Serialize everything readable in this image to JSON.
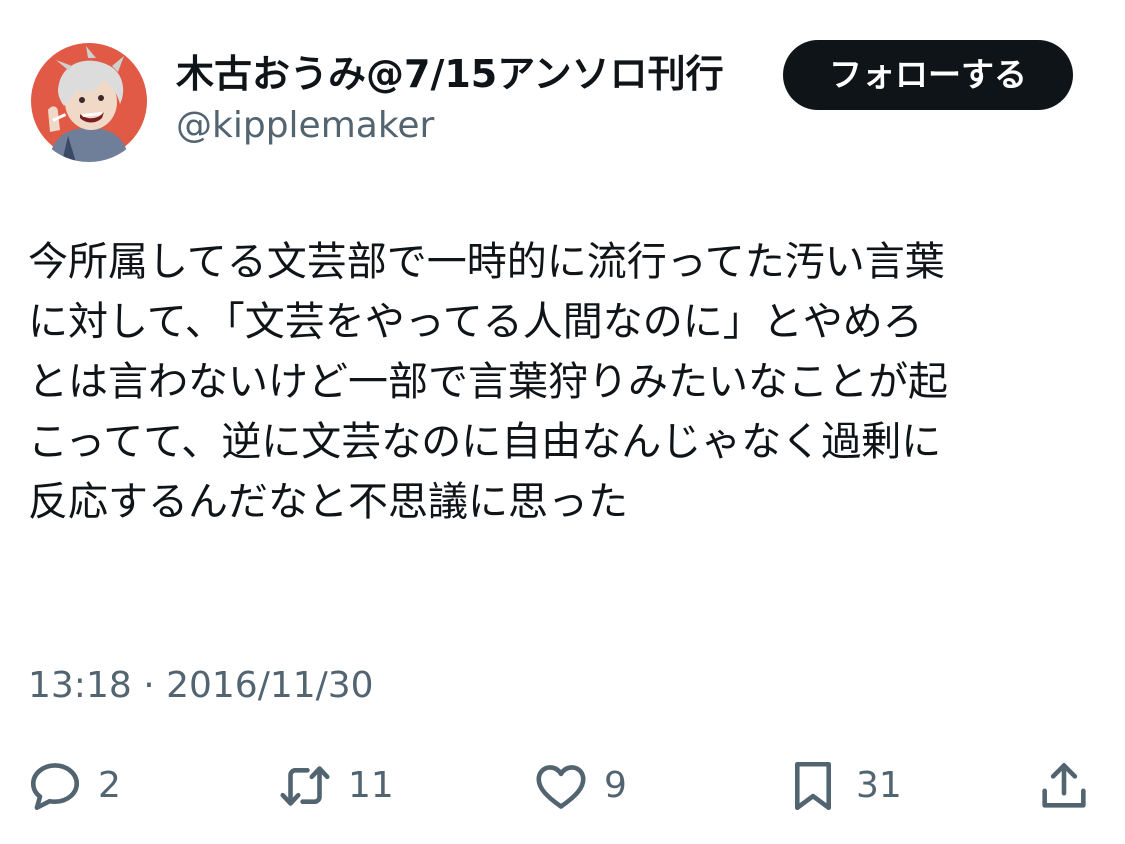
{
  "author": {
    "display_name": "木古おうみ@7/15アンソロ刊行",
    "handle": "@kipplemaker",
    "avatar": "illustrated-avatar"
  },
  "follow_button": {
    "label": "フォローする"
  },
  "tweet": {
    "lines": [
      "今所属してる文芸部で一時的に流行ってた汚い言葉",
      "に対して、「文芸をやってる人間なのに」とやめろ",
      "とは言わないけど一部で言葉狩りみたいなことが起",
      "こってて、逆に文芸なのに自由なんじゃなく過剰に",
      "反応するんだなと不思議に思った"
    ],
    "timestamp": "13:18 · 2016/11/30"
  },
  "actions": {
    "reply": {
      "icon": "reply-icon",
      "count": "2"
    },
    "retweet": {
      "icon": "retweet-icon",
      "count": "11"
    },
    "like": {
      "icon": "heart-icon",
      "count": "9"
    },
    "bookmark": {
      "icon": "bookmark-icon",
      "count": "31"
    },
    "share": {
      "icon": "share-icon"
    }
  },
  "colors": {
    "text": "#0f1419",
    "secondary": "#536471",
    "button_bg": "#0f1419",
    "button_text": "#ffffff"
  }
}
